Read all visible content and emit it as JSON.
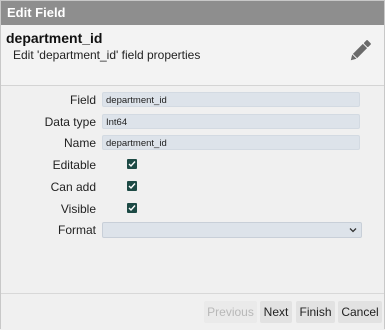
{
  "dialog": {
    "title": "Edit Field",
    "header_title": "department_id",
    "header_subtitle": "Edit 'department_id' field properties",
    "header_icon": "pencil-icon"
  },
  "form": {
    "field_label": "Field",
    "field_value": "department_id",
    "datatype_label": "Data type",
    "datatype_value": "Int64",
    "name_label": "Name",
    "name_value": "department_id",
    "editable_label": "Editable",
    "editable_checked": true,
    "canadd_label": "Can add",
    "canadd_checked": true,
    "visible_label": "Visible",
    "visible_checked": true,
    "format_label": "Format",
    "format_value": ""
  },
  "buttons": {
    "previous": "Previous",
    "next": "Next",
    "finish": "Finish",
    "cancel": "Cancel"
  },
  "colors": {
    "titlebar": "#8e8e8e",
    "checkbox": "#1d4a45",
    "input_bg": "#dde3ea"
  }
}
